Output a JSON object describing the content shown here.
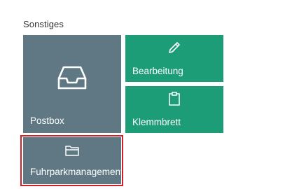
{
  "section": {
    "title": "Sonstiges"
  },
  "tiles": [
    {
      "label": "Postbox",
      "icon": "inbox-tray-icon",
      "color": "#5f7884"
    },
    {
      "label": "Bearbeitung",
      "icon": "pencil-icon",
      "color": "#1c9d77"
    },
    {
      "label": "Klemmbrett",
      "icon": "clipboard-icon",
      "color": "#1c9d77"
    },
    {
      "label": "Fuhrparkmanagement",
      "icon": "folder-icon",
      "color": "#5f7884"
    }
  ],
  "highlight": {
    "color": "#d0212b"
  }
}
